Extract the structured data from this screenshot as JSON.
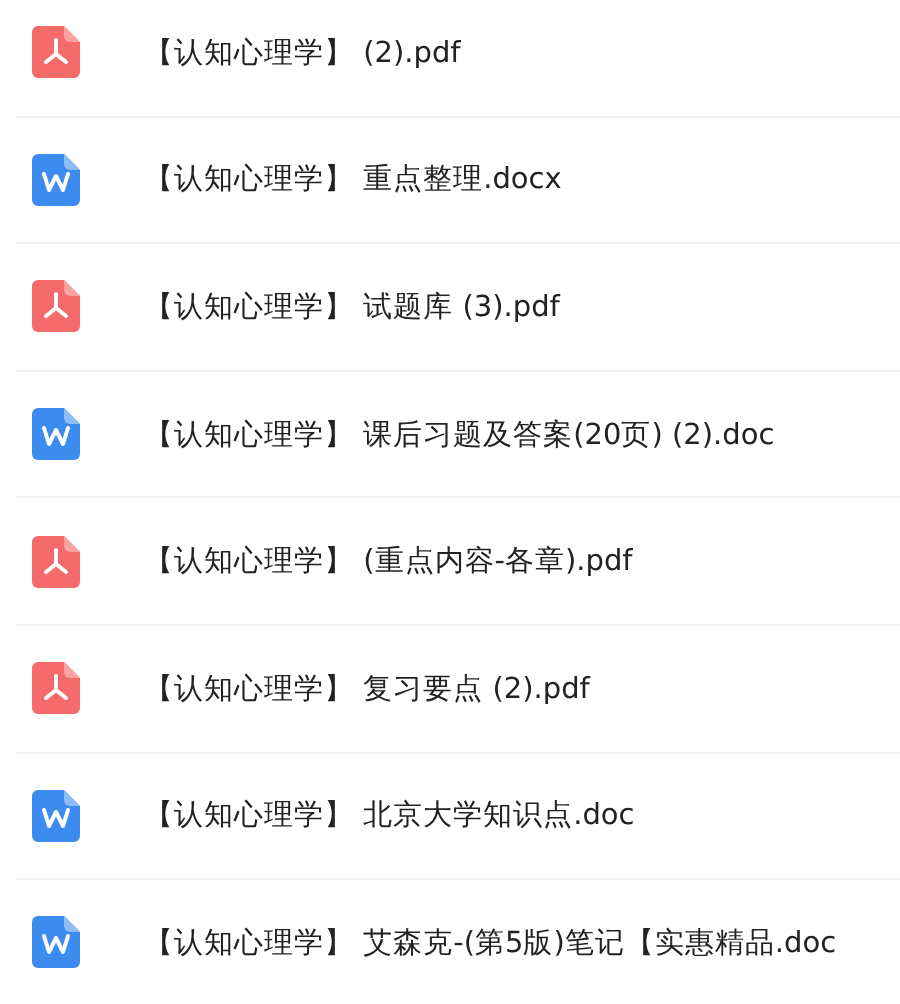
{
  "files": [
    {
      "kind": "pdf",
      "name": "【认知心理学】  (2).pdf"
    },
    {
      "kind": "word",
      "name": "【认知心理学】 重点整理.docx"
    },
    {
      "kind": "pdf",
      "name": "【认知心理学】 试题库 (3).pdf"
    },
    {
      "kind": "word",
      "name": "【认知心理学】 课后习题及答案(20页) (2).doc"
    },
    {
      "kind": "pdf",
      "name": "【认知心理学】 (重点内容-各章).pdf"
    },
    {
      "kind": "pdf",
      "name": "【认知心理学】 复习要点 (2).pdf"
    },
    {
      "kind": "word",
      "name": "【认知心理学】 北京大学知识点.doc"
    },
    {
      "kind": "word",
      "name": "【认知心理学】 艾森克-(第5版)笔记【实惠精品.doc"
    }
  ]
}
